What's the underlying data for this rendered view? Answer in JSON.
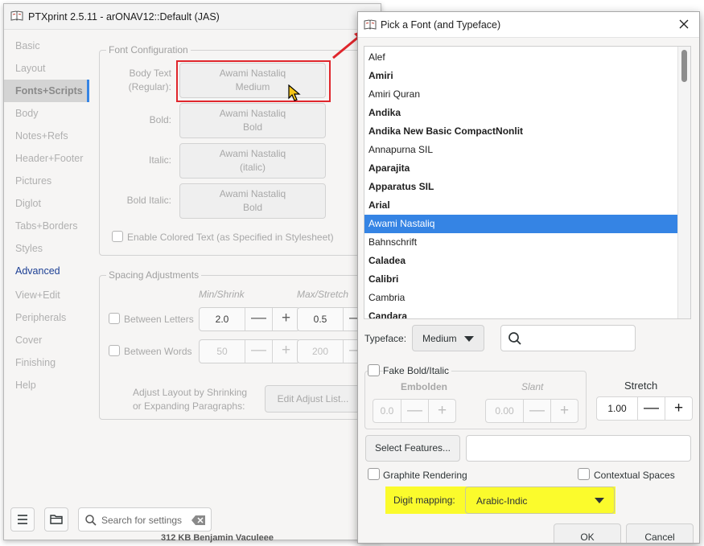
{
  "main_window": {
    "title": "PTXprint 2.5.11  -  arONAV12::Default  (JAS)",
    "sidebar": [
      {
        "label": "Basic",
        "state": "disabled"
      },
      {
        "label": "Layout",
        "state": "disabled"
      },
      {
        "label": "Fonts+Scripts",
        "state": "active"
      },
      {
        "label": "Body",
        "state": "disabled"
      },
      {
        "label": "Notes+Refs",
        "state": "disabled"
      },
      {
        "label": "Header+Footer",
        "state": "disabled"
      },
      {
        "label": "Pictures",
        "state": "disabled"
      },
      {
        "label": "Diglot",
        "state": "disabled"
      },
      {
        "label": "Tabs+Borders",
        "state": "disabled"
      },
      {
        "label": "Styles",
        "state": "disabled"
      },
      {
        "label": "Advanced",
        "state": "link"
      },
      {
        "label": "View+Edit",
        "state": "disabled"
      },
      {
        "label": "Peripherals",
        "state": "disabled"
      },
      {
        "label": "Cover",
        "state": "disabled"
      },
      {
        "label": "Finishing",
        "state": "disabled"
      },
      {
        "label": "Help",
        "state": "disabled"
      }
    ],
    "font_config": {
      "legend": "Font Configuration",
      "body_text_label_1": "Body Text",
      "body_text_label_2": "(Regular):",
      "body_text_font": "Awami Nastaliq",
      "body_text_style": "Medium",
      "bold_label": "Bold:",
      "bold_font": "Awami Nastaliq",
      "bold_style": "Bold",
      "italic_label": "Italic:",
      "italic_font": "Awami Nastaliq",
      "italic_style": "(italic)",
      "bold_italic_label": "Bold Italic:",
      "bold_italic_font": "Awami Nastaliq",
      "bold_italic_style": "Bold",
      "colored_text_label": "Enable Colored Text (as Specified in Stylesheet)"
    },
    "spacing": {
      "legend": "Spacing Adjustments",
      "min_header": "Min/Shrink",
      "max_header": "Max/Stretch",
      "between_letters_label": "Between Letters",
      "letters_min": "2.0",
      "letters_max": "0.5",
      "between_words_label": "Between Words",
      "words_min": "50",
      "words_max": "200",
      "adjust_layout_line1": "Adjust Layout by Shrinking",
      "adjust_layout_line2": "or Expanding Paragraphs:",
      "edit_adjust_button": "Edit Adjust List...",
      "minus": "—",
      "plus": "+"
    },
    "bottom": {
      "search_placeholder": "Search for settings",
      "cut_off_text": "312 KB        Benjamin Vaculeee"
    }
  },
  "dialog": {
    "title": "Pick a Font (and Typeface)",
    "fonts": [
      {
        "name": "Alef",
        "bold": false,
        "selected": false
      },
      {
        "name": "Amiri",
        "bold": true,
        "selected": false
      },
      {
        "name": "Amiri Quran",
        "bold": false,
        "selected": false
      },
      {
        "name": "Andika",
        "bold": true,
        "selected": false
      },
      {
        "name": "Andika New Basic CompactNonlit",
        "bold": true,
        "selected": false
      },
      {
        "name": "Annapurna SIL",
        "bold": false,
        "selected": false
      },
      {
        "name": "Aparajita",
        "bold": true,
        "selected": false
      },
      {
        "name": "Apparatus SIL",
        "bold": true,
        "selected": false
      },
      {
        "name": "Arial",
        "bold": true,
        "selected": false
      },
      {
        "name": "Awami Nastaliq",
        "bold": false,
        "selected": true
      },
      {
        "name": "Bahnschrift",
        "bold": false,
        "selected": false
      },
      {
        "name": "Caladea",
        "bold": true,
        "selected": false
      },
      {
        "name": "Calibri",
        "bold": true,
        "selected": false
      },
      {
        "name": "Cambria",
        "bold": false,
        "selected": false
      },
      {
        "name": "Candara",
        "bold": true,
        "selected": false
      }
    ],
    "typeface_label": "Typeface:",
    "typeface_value": "Medium",
    "fake_bold_label": "Fake Bold/Italic",
    "embolden_label": "Embolden",
    "embolden_value": "0.0",
    "slant_label": "Slant",
    "slant_value": "0.00",
    "stretch_label": "Stretch",
    "stretch_value": "1.00",
    "minus": "—",
    "plus": "+",
    "select_features_button": "Select Features...",
    "graphite_label": "Graphite Rendering",
    "contextual_spaces_label": "Contextual Spaces",
    "digit_mapping_label": "Digit mapping:",
    "digit_mapping_value": "Arabic-Indic",
    "ok_button": "OK",
    "cancel_button": "Cancel"
  },
  "colors": {
    "selection": "#3584e4",
    "highlight_yellow": "#fbfb2c",
    "annotation_red": "#e0262c"
  }
}
